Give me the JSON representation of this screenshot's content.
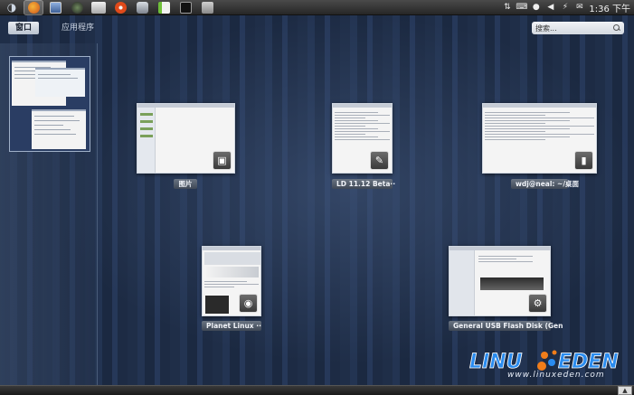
{
  "panel": {
    "launchers": [
      {
        "name": "ubuntu-logo-icon",
        "glyph": "◐",
        "color": "#d9d9d9"
      },
      {
        "name": "firefox-icon",
        "glyph": "",
        "color": "#e07b24",
        "active": true
      },
      {
        "name": "image-viewer-icon",
        "glyph": "",
        "color": "#5c7fb0"
      },
      {
        "name": "globe-icon",
        "glyph": "",
        "color": "#3b5a3a"
      },
      {
        "name": "file-manager-icon",
        "glyph": "",
        "color": "#bfbfbf"
      },
      {
        "name": "media-player-icon",
        "glyph": "",
        "color": "#e04a1a"
      },
      {
        "name": "camera-icon",
        "glyph": "",
        "color": "#8a9098"
      },
      {
        "name": "text-editor-icon",
        "glyph": "",
        "color": "#6fbf3a"
      },
      {
        "name": "terminal-icon",
        "glyph": "",
        "color": "#1a1a1a"
      },
      {
        "name": "settings-icon",
        "glyph": "",
        "color": "#a8a8a8"
      }
    ],
    "tray": [
      "network-icon",
      "keyboard-icon",
      "bluetooth-icon",
      "volume-icon",
      "power-icon",
      "mail-icon"
    ],
    "clock": "1:36 下午"
  },
  "overview": {
    "tabs": [
      {
        "label": "窗口",
        "selected": true
      },
      {
        "label": "应用程序",
        "selected": false
      }
    ],
    "search_placeholder": "搜索..."
  },
  "windows": [
    {
      "id": "pictures",
      "caption": "图片",
      "badge": "camera-icon",
      "badge_glyph": "▣"
    },
    {
      "id": "release-notes",
      "caption": "LD 11.12 Beta··",
      "badge": "text-editor-icon",
      "badge_glyph": "✎"
    },
    {
      "id": "terminal",
      "caption": "wdj@neal: ~/桌面",
      "badge": "terminal-icon",
      "badge_glyph": "▮"
    },
    {
      "id": "planet-linux",
      "caption": "Planet Linux ··",
      "badge": "firefox-icon",
      "badge_glyph": "◉"
    },
    {
      "id": "usb-disk",
      "caption": "General USB Flash Disk (Gen",
      "badge": "settings-icon",
      "badge_glyph": "⚙"
    }
  ],
  "watermark": {
    "name": "LINUX EDEN",
    "url": "www.linuxeden.com"
  },
  "colors": {
    "accent": "#2a8cf0",
    "logo_orange": "#f07d1a",
    "background": "#1e2d45"
  }
}
